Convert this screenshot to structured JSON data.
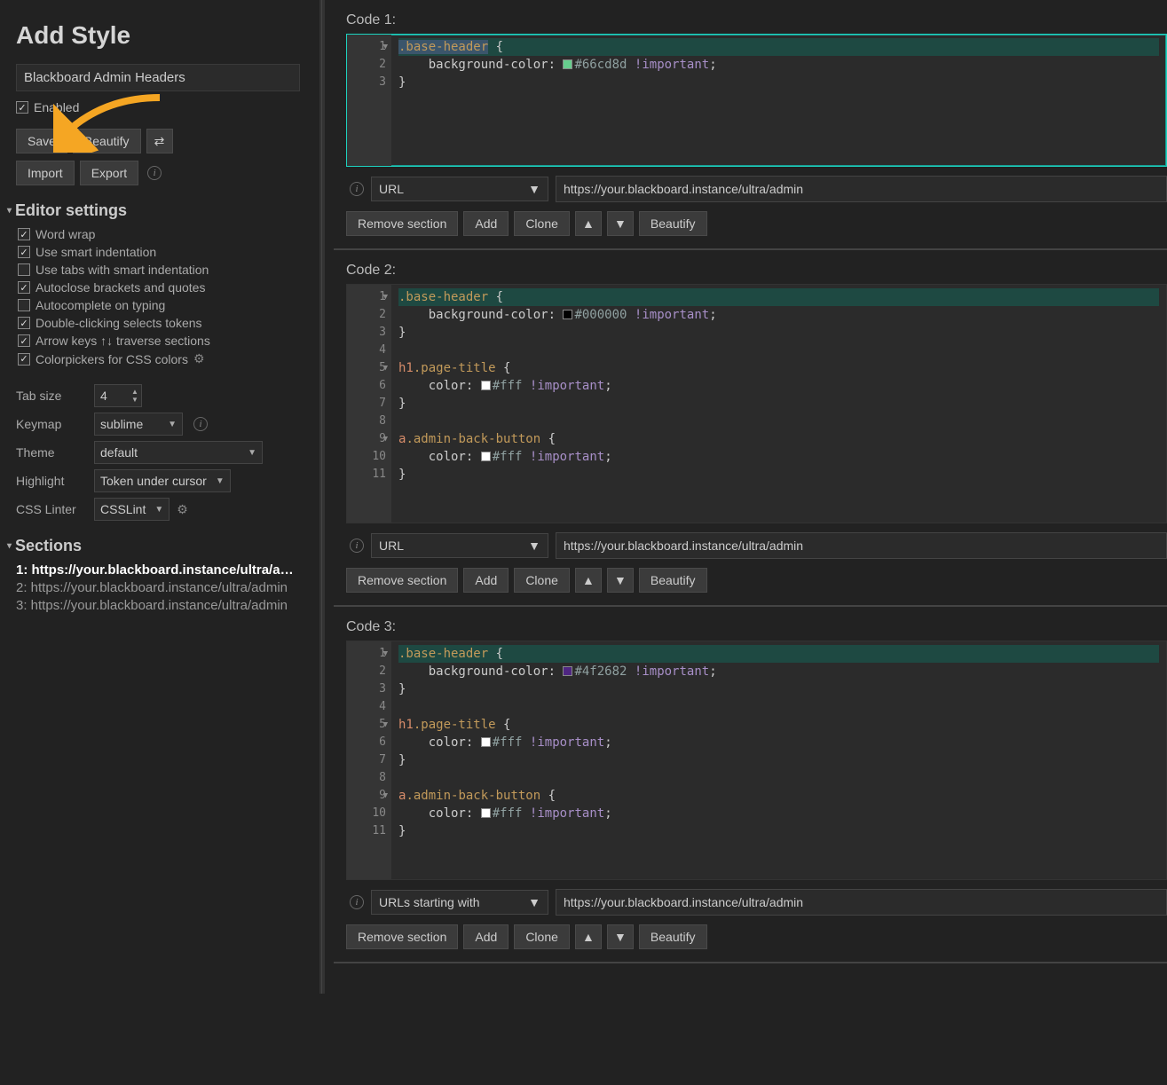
{
  "sidebar": {
    "title": "Add Style",
    "style_name": "Blackboard Admin Headers",
    "enabled_label": "Enabled",
    "enabled": true,
    "buttons": {
      "save": "Save",
      "beautify": "Beautify",
      "reverse": "⇄",
      "import": "Import",
      "export": "Export"
    },
    "editor_settings": {
      "heading": "Editor settings",
      "options": [
        {
          "label": "Word wrap",
          "checked": true
        },
        {
          "label": "Use smart indentation",
          "checked": true
        },
        {
          "label": "Use tabs with smart indentation",
          "checked": false
        },
        {
          "label": "Autoclose brackets and quotes",
          "checked": true
        },
        {
          "label": "Autocomplete on typing",
          "checked": false
        },
        {
          "label": "Double-clicking selects tokens",
          "checked": true
        },
        {
          "label": "Arrow keys ↑↓ traverse sections",
          "checked": true
        },
        {
          "label": "Colorpickers for CSS colors",
          "checked": true,
          "gear": true
        }
      ],
      "tab_size_label": "Tab size",
      "tab_size": "4",
      "keymap_label": "Keymap",
      "keymap": "sublime",
      "theme_label": "Theme",
      "theme": "default",
      "highlight_label": "Highlight",
      "highlight": "Token under cursor",
      "linter_label": "CSS Linter",
      "linter": "CSSLint"
    },
    "sections": {
      "heading": "Sections",
      "items": [
        {
          "idx": "1",
          "label": "https://your.blackboard.instance/ultra/a…",
          "active": true
        },
        {
          "idx": "2",
          "label": "https://your.blackboard.instance/ultra/admin",
          "active": false
        },
        {
          "idx": "3",
          "label": "https://your.blackboard.instance/ultra/admin",
          "active": false
        }
      ]
    }
  },
  "code_blocks": [
    {
      "label": "Code 1:",
      "active": true,
      "code_lines": [
        {
          "n": "1",
          "fold": true,
          "html": "<span class=\"hl-line\"><span class=\"sel-highlight c-sel\">.base-header</span> <span class=\"c-punc\">{</span></span>"
        },
        {
          "n": "2",
          "html": "    <span class=\"c-prop\">background-color</span><span class=\"c-punc\">:</span> <span class=\"c-swatch\" style=\"background:#66cd8d\"></span><span class=\"c-color\">#66cd8d</span> <span class=\"c-imp\">!important</span><span class=\"c-punc\">;</span>"
        },
        {
          "n": "3",
          "html": "<span class=\"c-punc\">}</span>"
        }
      ],
      "pad_lines": 4,
      "applies_type": "URL",
      "applies_url": "https://your.blackboard.instance/ultra/admin",
      "buttons": {
        "remove": "Remove section",
        "add": "Add",
        "clone": "Clone",
        "beautify": "Beautify"
      }
    },
    {
      "label": "Code 2:",
      "active": false,
      "code_lines": [
        {
          "n": "1",
          "fold": true,
          "html": "<span class=\"hl-line\"><span class=\"c-sel\">.base-header</span> <span class=\"c-punc\">{</span></span>"
        },
        {
          "n": "2",
          "html": "    <span class=\"c-prop\">background-color</span><span class=\"c-punc\">:</span> <span class=\"c-swatch\" style=\"background:#000\"></span><span class=\"c-color\">#000000</span> <span class=\"c-imp\">!important</span><span class=\"c-punc\">;</span>"
        },
        {
          "n": "3",
          "html": "<span class=\"c-punc\">}</span>"
        },
        {
          "n": "4",
          "html": ""
        },
        {
          "n": "5",
          "fold": true,
          "html": "<span class=\"c-tag\">h1</span><span class=\"c-sel\">.page-title</span> <span class=\"c-punc\">{</span>"
        },
        {
          "n": "6",
          "html": "    <span class=\"c-prop\">color</span><span class=\"c-punc\">:</span> <span class=\"c-swatch\" style=\"background:#fff\"></span><span class=\"c-color\">#fff</span> <span class=\"c-imp\">!important</span><span class=\"c-punc\">;</span>"
        },
        {
          "n": "7",
          "html": "<span class=\"c-punc\">}</span>"
        },
        {
          "n": "8",
          "html": ""
        },
        {
          "n": "9",
          "fold": true,
          "html": "<span class=\"c-tag\">a</span><span class=\"c-sel\">.admin-back-button</span> <span class=\"c-punc\">{</span>"
        },
        {
          "n": "10",
          "html": "    <span class=\"c-prop\">color</span><span class=\"c-punc\">:</span> <span class=\"c-swatch\" style=\"background:#fff\"></span><span class=\"c-color\">#fff</span> <span class=\"c-imp\">!important</span><span class=\"c-punc\">;</span>"
        },
        {
          "n": "11",
          "html": "<span class=\"c-punc\">}</span>"
        }
      ],
      "pad_lines": 2,
      "applies_type": "URL",
      "applies_url": "https://your.blackboard.instance/ultra/admin",
      "buttons": {
        "remove": "Remove section",
        "add": "Add",
        "clone": "Clone",
        "beautify": "Beautify"
      }
    },
    {
      "label": "Code 3:",
      "active": false,
      "code_lines": [
        {
          "n": "1",
          "fold": true,
          "html": "<span class=\"hl-line\"><span class=\"c-sel\">.base-header</span> <span class=\"c-punc\">{</span></span>"
        },
        {
          "n": "2",
          "html": "    <span class=\"c-prop\">background-color</span><span class=\"c-punc\">:</span> <span class=\"c-swatch\" style=\"background:#4f2682\"></span><span class=\"c-color\">#4f2682</span> <span class=\"c-imp\">!important</span><span class=\"c-punc\">;</span>"
        },
        {
          "n": "3",
          "html": "<span class=\"c-punc\">}</span>"
        },
        {
          "n": "4",
          "html": ""
        },
        {
          "n": "5",
          "fold": true,
          "html": "<span class=\"c-tag\">h1</span><span class=\"c-sel\">.page-title</span> <span class=\"c-punc\">{</span>"
        },
        {
          "n": "6",
          "html": "    <span class=\"c-prop\">color</span><span class=\"c-punc\">:</span> <span class=\"c-swatch\" style=\"background:#fff\"></span><span class=\"c-color\">#fff</span> <span class=\"c-imp\">!important</span><span class=\"c-punc\">;</span>"
        },
        {
          "n": "7",
          "html": "<span class=\"c-punc\">}</span>"
        },
        {
          "n": "8",
          "html": ""
        },
        {
          "n": "9",
          "fold": true,
          "html": "<span class=\"c-tag\">a</span><span class=\"c-sel\">.admin-back-button</span> <span class=\"c-punc\">{</span>"
        },
        {
          "n": "10",
          "html": "    <span class=\"c-prop\">color</span><span class=\"c-punc\">:</span> <span class=\"c-swatch\" style=\"background:#fff\"></span><span class=\"c-color\">#fff</span> <span class=\"c-imp\">!important</span><span class=\"c-punc\">;</span>"
        },
        {
          "n": "11",
          "html": "<span class=\"c-punc\">}</span>"
        }
      ],
      "pad_lines": 2,
      "applies_type": "URLs starting with",
      "applies_url": "https://your.blackboard.instance/ultra/admin",
      "buttons": {
        "remove": "Remove section",
        "add": "Add",
        "clone": "Clone",
        "beautify": "Beautify"
      }
    }
  ]
}
